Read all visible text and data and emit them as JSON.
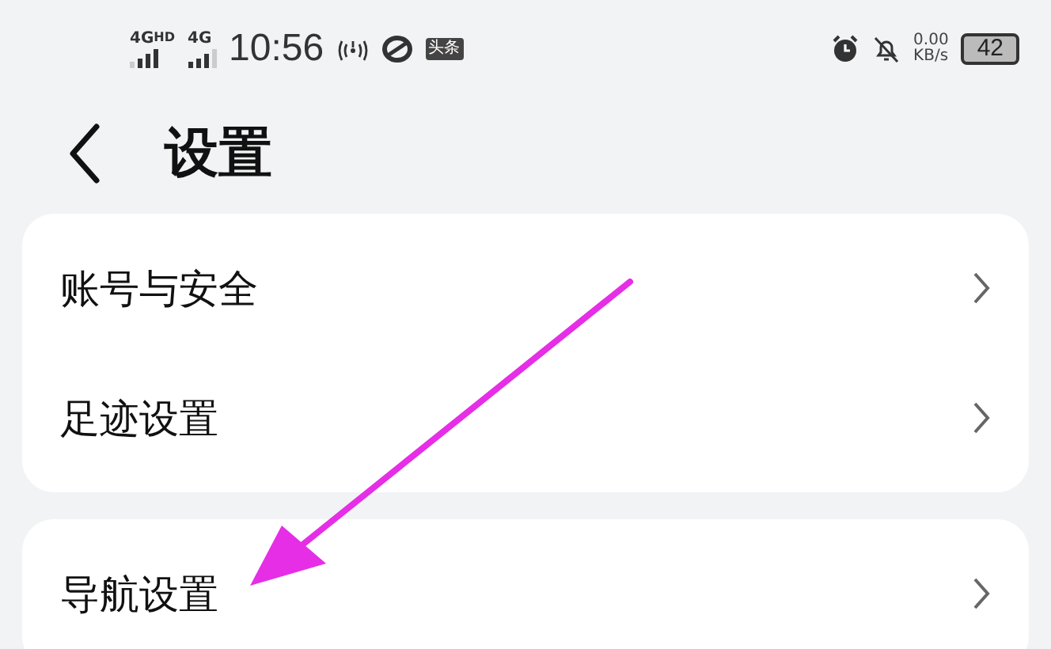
{
  "status_bar": {
    "sim_1": "4G$^{HD}$",
    "sim_2": "4G",
    "time": "10:56",
    "app_badge": "头条",
    "data_rate": "0.00",
    "data_rate_unit": "KB/s",
    "battery": "42"
  },
  "header": {
    "title": "设置"
  },
  "groups": [
    {
      "items": [
        {
          "label": "账号与安全"
        },
        {
          "label": "足迹设置"
        }
      ]
    },
    {
      "items": [
        {
          "label": "导航设置"
        }
      ]
    }
  ]
}
